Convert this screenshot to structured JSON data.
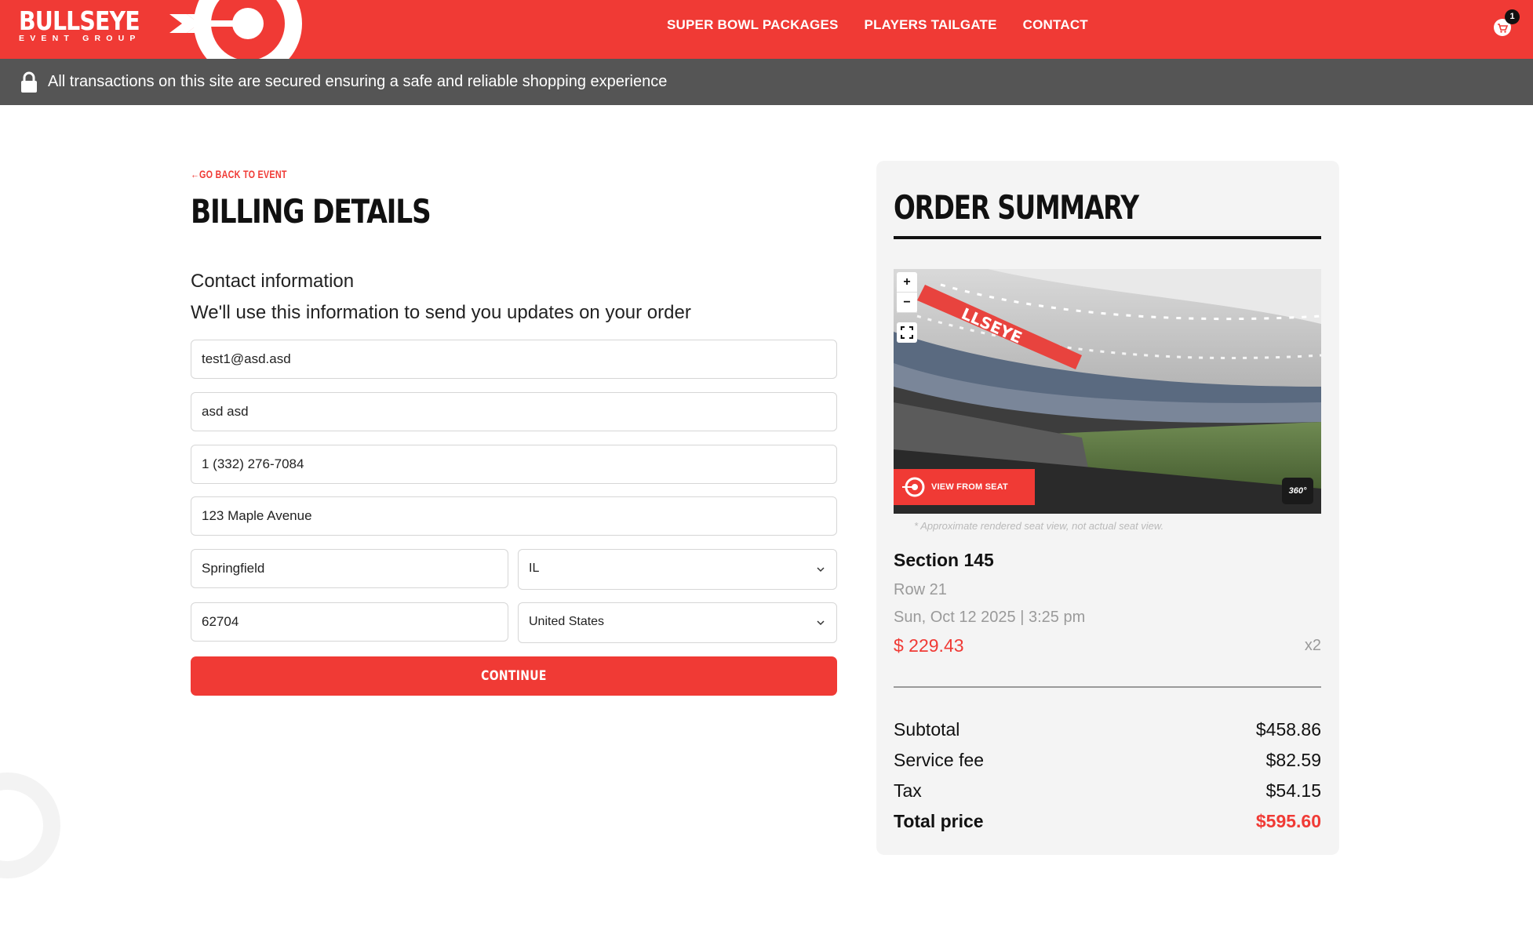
{
  "header": {
    "logo_main": "BULLSEYE",
    "logo_sub": "EVENT GROUP",
    "nav": [
      "SUPER BOWL PACKAGES",
      "PLAYERS TAILGATE",
      "CONTACT"
    ],
    "cart_count": "1",
    "brand_color": "#f03a35"
  },
  "secure_bar": {
    "text": "All transactions on this site are secured ensuring a safe and reliable shopping experience",
    "icon": "lock-icon"
  },
  "billing": {
    "back_link": "←GO BACK TO EVENT",
    "title": "BILLING DETAILS",
    "contact_title": "Contact information",
    "contact_desc": "We'll use this information to send you updates on your order",
    "fields": {
      "email": "test1@asd.asd",
      "name": "asd asd",
      "phone": "1 (332) 276-7084",
      "address": "123 Maple Avenue",
      "city": "Springfield",
      "state": "IL",
      "zip": "62704",
      "country": "United States"
    },
    "continue_label": "CONTINUE"
  },
  "summary": {
    "title": "ORDER SUMMARY",
    "zoom_in": "+",
    "zoom_out": "−",
    "view_from_seat": "VIEW FROM SEAT",
    "badge_360": "360°",
    "seat_note": "* Approximate rendered seat view, not actual seat view.",
    "section": "Section 145",
    "row": "Row 21",
    "date": "Sun, Oct 12 2025 | 3:25 pm",
    "price": "$ 229.43",
    "quantity": "x2",
    "lines": [
      {
        "label": "Subtotal",
        "amount": "$458.86"
      },
      {
        "label": "Service fee",
        "amount": "$82.59"
      },
      {
        "label": "Tax",
        "amount": "$54.15"
      }
    ],
    "total": {
      "label": "Total price",
      "amount": "$595.60"
    }
  }
}
